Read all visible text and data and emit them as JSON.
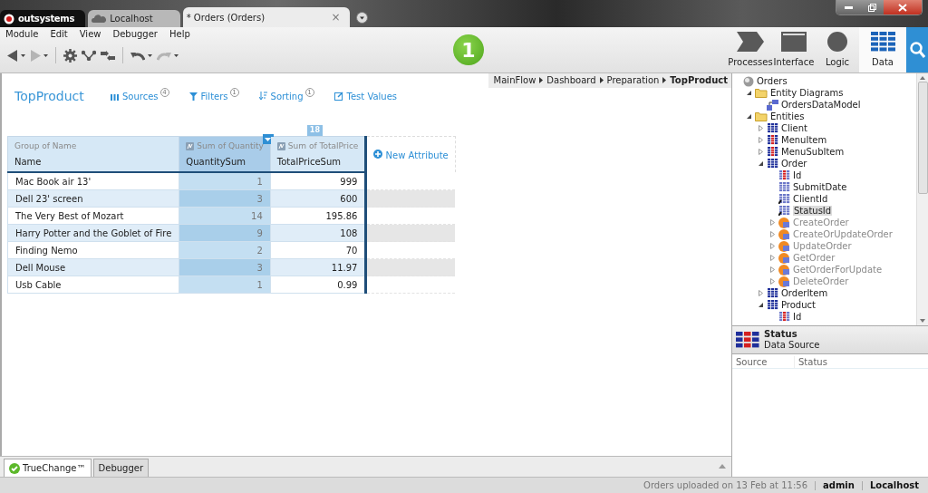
{
  "title_tabs": [
    {
      "kind": "brand",
      "label": "outsystems",
      "selected": false
    },
    {
      "kind": "server",
      "label": "Localhost",
      "selected": false
    },
    {
      "kind": "module",
      "label": "* Orders (Orders)",
      "selected": true,
      "close": "×"
    }
  ],
  "menu": [
    "Module",
    "Edit",
    "View",
    "Debugger",
    "Help"
  ],
  "toolbar": [
    {
      "kind": "back",
      "disabled": false
    },
    {
      "kind": "caret"
    },
    {
      "kind": "forward",
      "disabled": true
    },
    {
      "kind": "caret"
    },
    {
      "kind": "sep"
    },
    {
      "kind": "gear",
      "disabled": false
    },
    {
      "kind": "branch",
      "disabled": false
    },
    {
      "kind": "swap",
      "disabled": false
    },
    {
      "kind": "sep"
    },
    {
      "kind": "undo",
      "disabled": false
    },
    {
      "kind": "caret"
    },
    {
      "kind": "redo",
      "disabled": true
    },
    {
      "kind": "caret"
    }
  ],
  "step_badge": "1",
  "layer_tabs": [
    {
      "kind": "processes",
      "label": "Processes",
      "selected": false
    },
    {
      "kind": "interface",
      "label": "Interface",
      "selected": false
    },
    {
      "kind": "logic",
      "label": "Logic",
      "selected": false
    },
    {
      "kind": "data",
      "label": "Data",
      "selected": true
    }
  ],
  "breadcrumb": [
    {
      "label": "MainFlow",
      "current": false
    },
    {
      "label": "Dashboard",
      "current": false
    },
    {
      "label": "Preparation",
      "current": false
    },
    {
      "label": "TopProduct",
      "current": true
    }
  ],
  "editor": {
    "title": "TopProduct",
    "actions": [
      {
        "kind": "sources",
        "label": "Sources",
        "count": "4"
      },
      {
        "kind": "filters",
        "label": "Filters",
        "count": "1"
      },
      {
        "kind": "sorting",
        "label": "Sorting",
        "count": "1"
      },
      {
        "kind": "test",
        "label": "Test Values"
      }
    ],
    "column_count": "18",
    "columns": [
      {
        "group": "Group of Name",
        "name": "Name",
        "aggregate": false,
        "selected": false
      },
      {
        "group": "Sum of Quantity",
        "name": "QuantitySum",
        "aggregate": true,
        "selected": true
      },
      {
        "group": "Sum of TotalPrice",
        "name": "TotalPriceSum",
        "aggregate": true,
        "selected": false
      }
    ],
    "new_attribute": "New Attribute",
    "rows": [
      [
        "Mac Book air 13'",
        "1",
        "999"
      ],
      [
        "Dell 23' screen",
        "3",
        "600"
      ],
      [
        "The Very Best of Mozart",
        "14",
        "195.86"
      ],
      [
        "Harry Potter and the Goblet of Fire",
        "9",
        "108"
      ],
      [
        "Finding Nemo",
        "2",
        "70"
      ],
      [
        "Dell Mouse",
        "3",
        "11.97"
      ],
      [
        "Usb Cable",
        "1",
        "0.99"
      ]
    ]
  },
  "tree": [
    {
      "label": "Orders",
      "kind": "root",
      "selected": false,
      "children": [
        {
          "label": "Entity Diagrams",
          "kind": "folder",
          "expanded": true,
          "selected": false,
          "children": [
            {
              "label": "OrdersDataModel",
              "kind": "diagram",
              "selected": false
            }
          ]
        },
        {
          "label": "Entities",
          "kind": "folder",
          "expanded": true,
          "selected": false,
          "children": [
            {
              "label": "Client",
              "kind": "entity",
              "expanded": false,
              "selected": false
            },
            {
              "label": "MenuItem",
              "kind": "static",
              "expanded": false,
              "selected": false
            },
            {
              "label": "MenuSubItem",
              "kind": "static",
              "expanded": false,
              "selected": false
            },
            {
              "label": "Order",
              "kind": "entity",
              "expanded": true,
              "selected": false,
              "children": [
                {
                  "label": "Id",
                  "kind": "id",
                  "selected": false
                },
                {
                  "label": "SubmitDate",
                  "kind": "attribute",
                  "selected": false
                },
                {
                  "label": "ClientId",
                  "kind": "fk",
                  "selected": false
                },
                {
                  "label": "StatusId",
                  "kind": "fk",
                  "selected": true
                },
                {
                  "label": "CreateOrder",
                  "kind": "action",
                  "expanded": false,
                  "selected": false
                },
                {
                  "label": "CreateOrUpdateOrder",
                  "kind": "action",
                  "expanded": false,
                  "selected": false
                },
                {
                  "label": "UpdateOrder",
                  "kind": "action",
                  "expanded": false,
                  "selected": false
                },
                {
                  "label": "GetOrder",
                  "kind": "action",
                  "expanded": false,
                  "selected": false
                },
                {
                  "label": "GetOrderForUpdate",
                  "kind": "action",
                  "expanded": false,
                  "selected": false
                },
                {
                  "label": "DeleteOrder",
                  "kind": "action",
                  "expanded": false,
                  "selected": false
                }
              ]
            },
            {
              "label": "OrderItem",
              "kind": "entity",
              "expanded": false,
              "selected": false
            },
            {
              "label": "Product",
              "kind": "entity",
              "expanded": true,
              "selected": false,
              "children": [
                {
                  "label": "Id",
                  "kind": "id",
                  "selected": false
                }
              ]
            }
          ]
        }
      ]
    }
  ],
  "properties": {
    "title": "Status",
    "subtitle": "Data Source",
    "columns": [
      "Source",
      "Status"
    ]
  },
  "bottom_tabs": [
    {
      "kind": "truechange",
      "label": "TrueChange™",
      "selected": true
    },
    {
      "kind": "debugger",
      "label": "Debugger",
      "selected": false
    }
  ],
  "status_bar": [
    "Orders uploaded on 13 Feb at 11:56",
    "admin",
    "Localhost"
  ]
}
